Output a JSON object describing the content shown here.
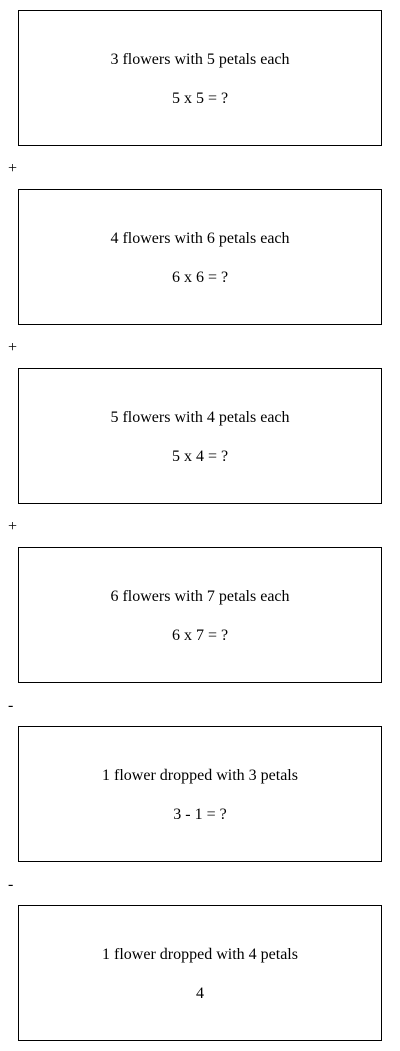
{
  "cards": [
    {
      "description": "3 flowers with 5 petals each",
      "expression": "5 x 5 = ?"
    },
    {
      "description": "4 flowers with 6 petals each",
      "expression": "6 x 6 = ?"
    },
    {
      "description": "5 flowers with 4 petals each",
      "expression": "5 x 4 = ?"
    },
    {
      "description": "6 flowers with 7 petals each",
      "expression": "6 x 7 = ?"
    },
    {
      "description": "1 flower dropped with 3 petals",
      "expression": "3 - 1 = ?"
    },
    {
      "description": "1 flower dropped with 4 petals",
      "expression": "4"
    }
  ],
  "operators": [
    "+",
    "+",
    "+",
    "-",
    "-"
  ]
}
